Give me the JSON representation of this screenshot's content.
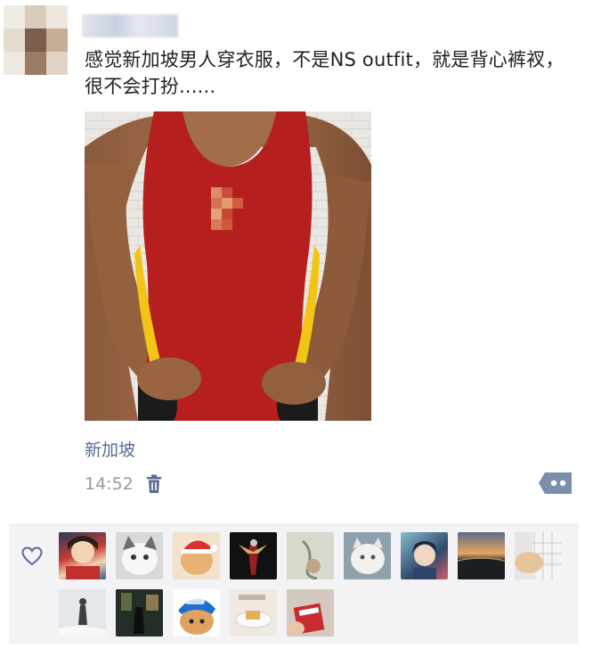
{
  "post": {
    "text": "感觉新加坡男人穿衣服，不是NS outfit，就是背心裤衩，很不会打扮......",
    "location": "新加坡",
    "time": "14:52"
  },
  "icons": {
    "avatar": "blurred-avatar",
    "username": "blurred-username",
    "trash": "trash-icon",
    "comment": "comment-more-icon",
    "heart": "heart-outline-icon"
  },
  "likes": {
    "count": 14,
    "avatars": [
      "anime-girl-avatar",
      "white-cat-avatar",
      "cat-santa-avatar",
      "dark-figure-avatar",
      "sketch-avatar",
      "fluffy-cat-avatar",
      "anime-boy-avatar",
      "sunset-avatar",
      "keyboard-cat-avatar",
      "snow-person-avatar",
      "dark-street-avatar",
      "cat-cap-avatar",
      "food-plate-avatar",
      "red-drink-avatar"
    ]
  },
  "colors": {
    "link": "#576b95",
    "time": "#999999",
    "panel": "#f3f3f5",
    "jersey_red": "#b5201f",
    "jersey_yellow": "#f2c416"
  }
}
